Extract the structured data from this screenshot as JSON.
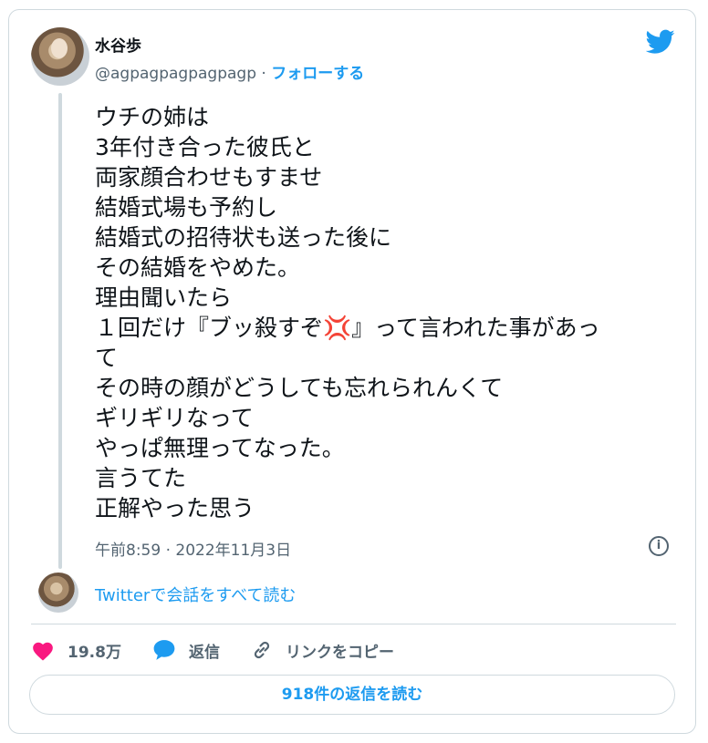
{
  "user": {
    "name": "水谷歩",
    "handle": "@agpagpagpagpagp",
    "separator": "·",
    "follow_label": "フォローする"
  },
  "tweet": {
    "lines": [
      "ウチの姉は",
      "3年付き合った彼氏と",
      "両家顔合わせもすませ",
      "結婚式場も予約し",
      "結婚式の招待状も送った後に",
      "その結婚をやめた。",
      "理由聞いたら",
      "１回だけ『ブッ殺すぞ",
      "』って言われた事があっ",
      "て",
      "その時の顔がどうしても忘れられんくて",
      "ギリギリなって",
      "やっぱ無理ってなった。",
      "言うてた",
      "正解やった思う"
    ],
    "anger_symbol": "💢",
    "timestamp": "午前8:59 · 2022年11月3日"
  },
  "conversation": {
    "read_all_label": "Twitterで会話をすべて読む"
  },
  "actions": {
    "likes": "19.8万",
    "reply_label": "返信",
    "copy_link_label": "リンクをコピー"
  },
  "read_replies_label": "918件の返信を読む",
  "colors": {
    "accent": "#1d9bf0",
    "like": "#f91880",
    "muted": "#536471",
    "border": "#cfd9de"
  },
  "icons": [
    "twitter-bird-icon",
    "info-icon",
    "heart-icon",
    "reply-bubble-icon",
    "link-icon"
  ]
}
